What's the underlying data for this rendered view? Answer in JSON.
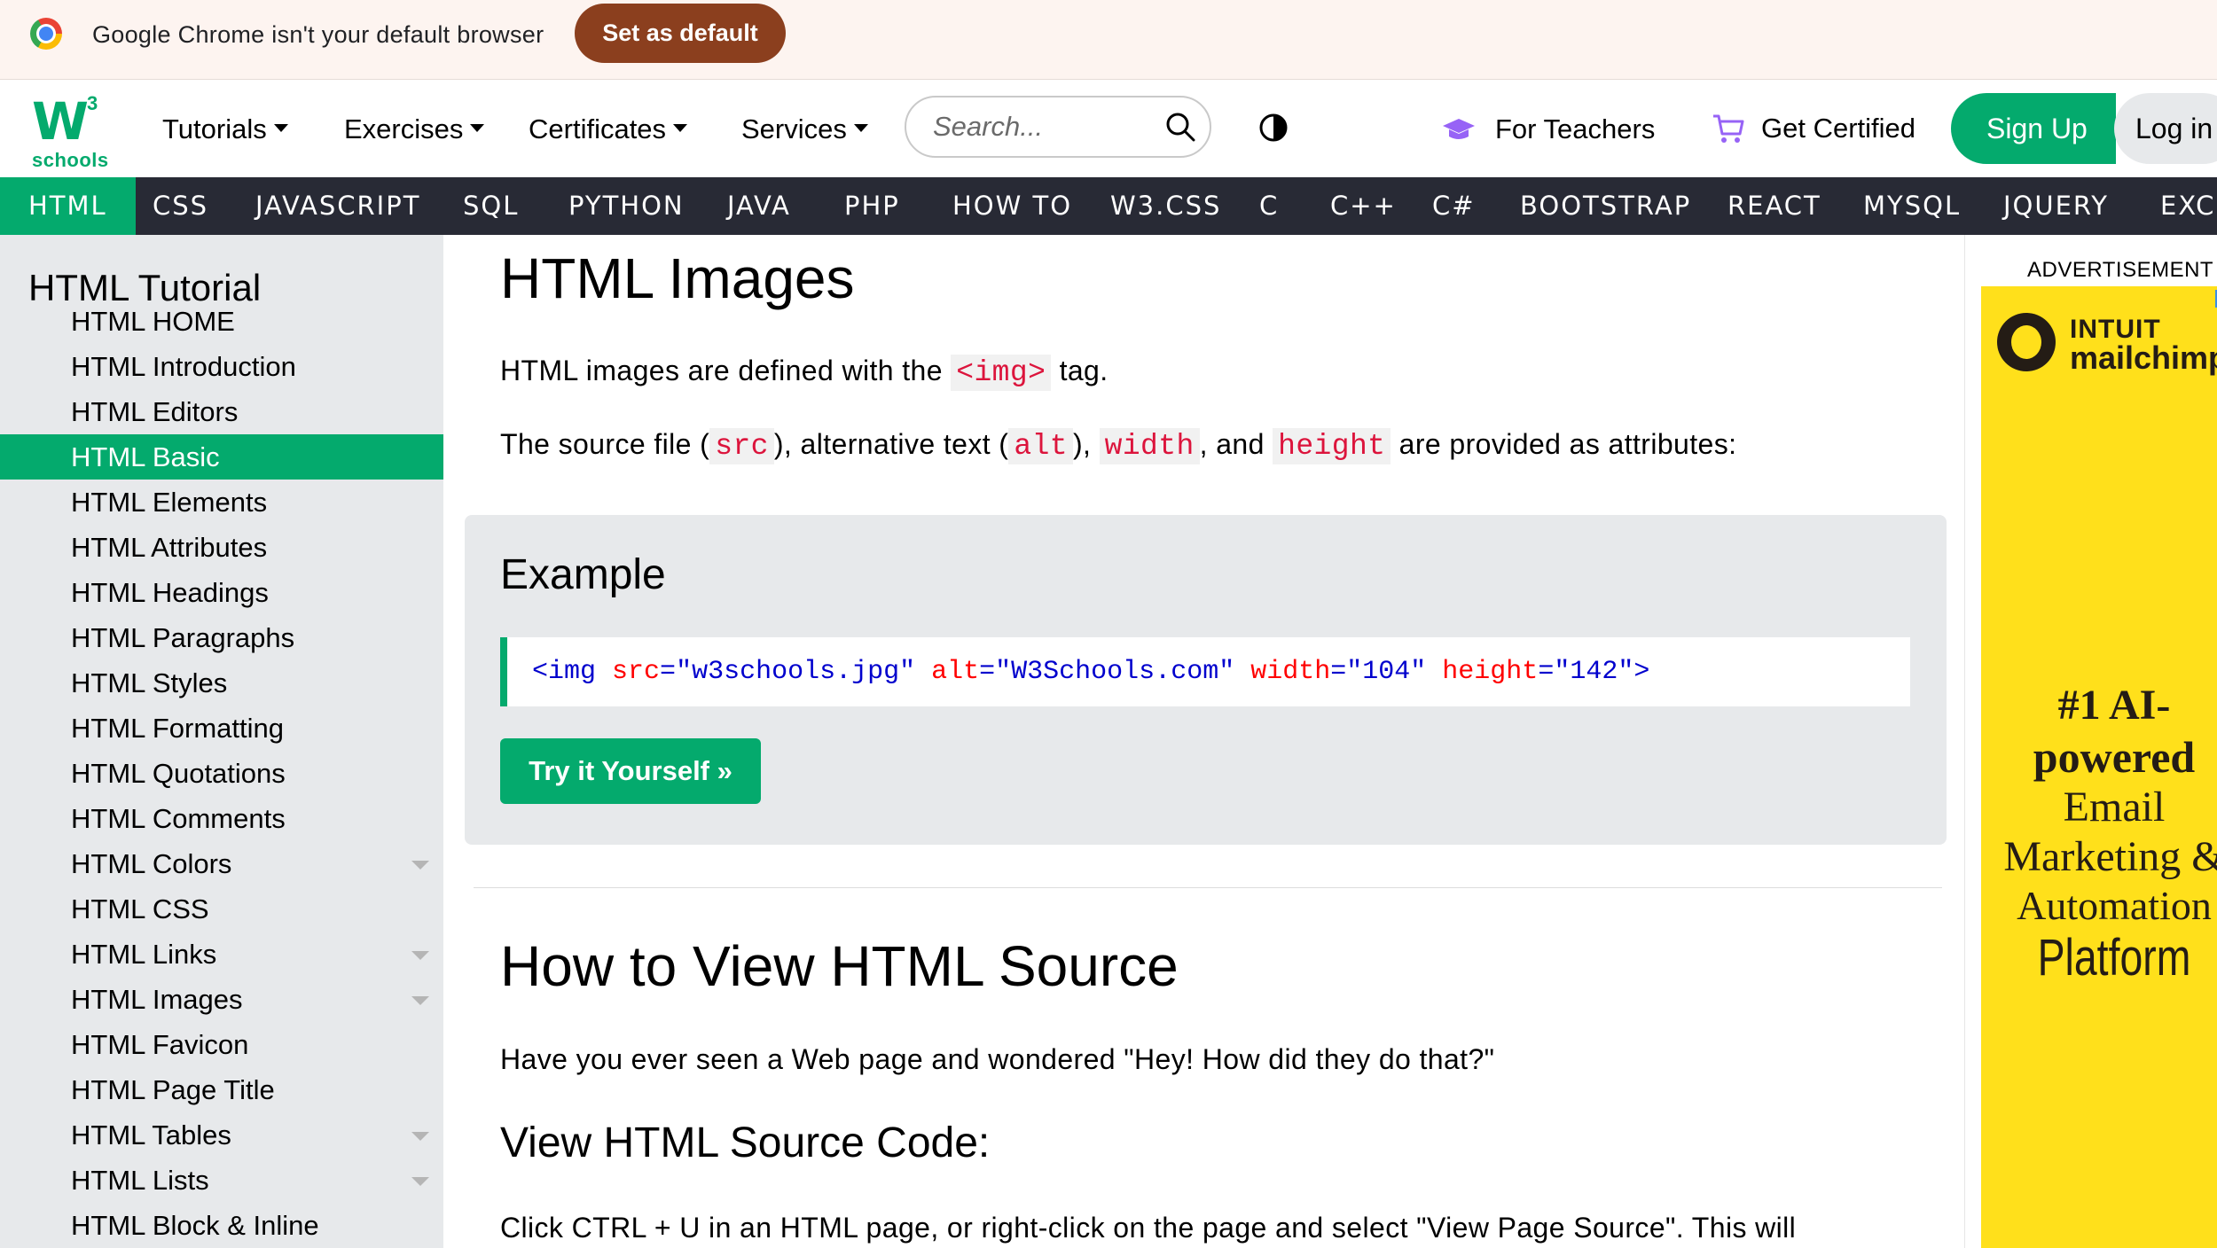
{
  "infobar": {
    "message": "Google Chrome isn't your default browser",
    "button": "Set as default"
  },
  "topnav": {
    "logo_mark": "W",
    "logo_sup": "3",
    "logo_text": "schools",
    "menu": [
      "Tutorials",
      "Exercises",
      "Certificates",
      "Services"
    ],
    "search_placeholder": "Search...",
    "for_teachers": "For Teachers",
    "get_certified": "Get Certified",
    "sign_up": "Sign Up",
    "log_in": "Log in"
  },
  "subjects": [
    "HTML",
    "CSS",
    "JAVASCRIPT",
    "SQL",
    "PYTHON",
    "JAVA",
    "PHP",
    "HOW TO",
    "W3.CSS",
    "C",
    "C++",
    "C#",
    "BOOTSTRAP",
    "REACT",
    "MYSQL",
    "JQUERY",
    "EXCEL"
  ],
  "sidebar": {
    "title": "HTML Tutorial",
    "items": [
      {
        "label": "HTML HOME"
      },
      {
        "label": "HTML Introduction"
      },
      {
        "label": "HTML Editors"
      },
      {
        "label": "HTML Basic",
        "active": true
      },
      {
        "label": "HTML Elements"
      },
      {
        "label": "HTML Attributes"
      },
      {
        "label": "HTML Headings"
      },
      {
        "label": "HTML Paragraphs"
      },
      {
        "label": "HTML Styles"
      },
      {
        "label": "HTML Formatting"
      },
      {
        "label": "HTML Quotations"
      },
      {
        "label": "HTML Comments"
      },
      {
        "label": "HTML Colors",
        "expandable": true
      },
      {
        "label": "HTML CSS"
      },
      {
        "label": "HTML Links",
        "expandable": true
      },
      {
        "label": "HTML Images",
        "expandable": true
      },
      {
        "label": "HTML Favicon"
      },
      {
        "label": "HTML Page Title"
      },
      {
        "label": "HTML Tables",
        "expandable": true
      },
      {
        "label": "HTML Lists",
        "expandable": true
      },
      {
        "label": "HTML Block & Inline"
      }
    ]
  },
  "main": {
    "title": "HTML Images",
    "p1_before": "HTML images are defined with the ",
    "p1_code": "<img>",
    "p1_after": " tag.",
    "p2_a": "The source file (",
    "p2_src": "src",
    "p2_b": "), alternative text (",
    "p2_alt": "alt",
    "p2_c": "), ",
    "p2_width": "width",
    "p2_d": ", and ",
    "p2_height": "height",
    "p2_e": " are provided as attributes:",
    "example_title": "Example",
    "code": {
      "tag_open": "<img",
      "a1": "src",
      "v1": "\"w3schools.jpg\"",
      "a2": "alt",
      "v2": "\"W3Schools.com\"",
      "a3": "width",
      "v3": "\"104\"",
      "a4": "height",
      "v4": "\"142\"",
      "tag_close": ">"
    },
    "try_button": "Try it Yourself »",
    "section_title": "How to View HTML Source",
    "section_p": "Have you ever seen a Web page and wondered \"Hey! How did they do that?\"",
    "sub_title": "View HTML Source Code:",
    "sub_p": "Click CTRL + U in an HTML page, or right-click on the page and select \"View Page Source\". This will"
  },
  "ad": {
    "label": "ADVERTISEMENT",
    "brand_top": "INTUIT",
    "brand_bottom": "mailchimp",
    "lines": [
      "#1 AI-",
      "powered",
      "Email",
      "Marketing &",
      "Automation",
      "Platform"
    ]
  },
  "colors": {
    "accent": "#04aa6d",
    "subject_bar": "#282a35",
    "sidebar_bg": "#e7e9eb",
    "code_red": "#dc143c",
    "ad_yellow": "#ffe01b",
    "infobar_button": "#8b3f1e"
  }
}
